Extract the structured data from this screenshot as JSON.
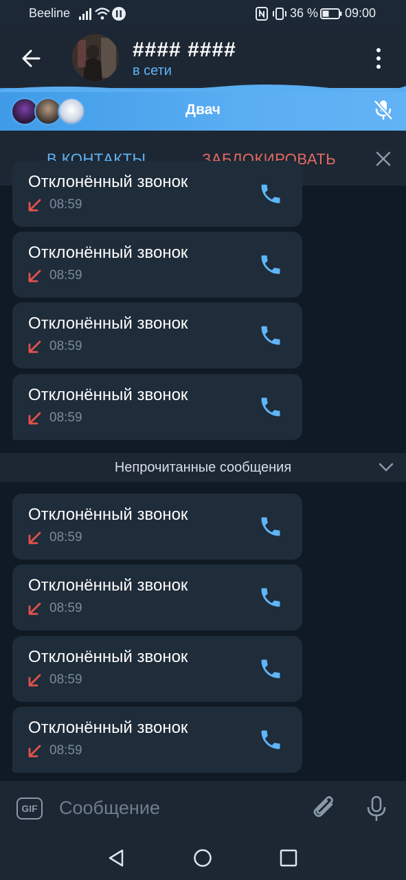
{
  "status_bar": {
    "carrier": "Beeline",
    "battery_percent": "36 %",
    "time": "09:00"
  },
  "header": {
    "title": "#### ####",
    "status": "в сети"
  },
  "voice_chat": {
    "title": "Двач"
  },
  "actions": {
    "add_contact": "В КОНТАКТЫ",
    "block": "ЗАБЛОКИРОВАТЬ"
  },
  "messages_before": [
    {
      "title": "Отклонённый звонок",
      "time": "08:59"
    },
    {
      "title": "Отклонённый звонок",
      "time": "08:59"
    },
    {
      "title": "Отклонённый звонок",
      "time": "08:59"
    },
    {
      "title": "Отклонённый звонок",
      "time": "08:59"
    }
  ],
  "unread_divider": "Непрочитанные сообщения",
  "messages_after": [
    {
      "title": "Отклонённый звонок",
      "time": "08:59"
    },
    {
      "title": "Отклонённый звонок",
      "time": "08:59"
    },
    {
      "title": "Отклонённый звонок",
      "time": "08:59"
    },
    {
      "title": "Отклонённый звонок",
      "time": "08:59"
    }
  ],
  "composer": {
    "placeholder": "Сообщение",
    "gif_label": "GIF"
  },
  "colors": {
    "accent": "#5eb5f7",
    "danger": "#e46a63",
    "bubble": "#1f2c3a",
    "background": "#0f1a24"
  },
  "icons": {
    "back": "arrow-left-icon",
    "menu": "more-vertical-icon",
    "mute": "mic-off-icon",
    "close": "close-icon",
    "call": "phone-icon",
    "missed": "missed-call-arrow-icon",
    "attach": "paperclip-icon",
    "voice": "mic-icon"
  }
}
